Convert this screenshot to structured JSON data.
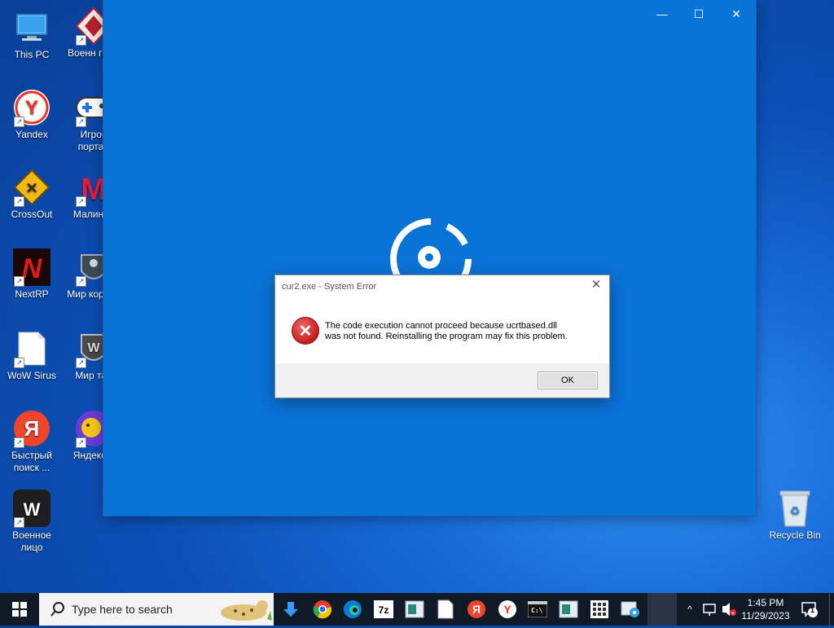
{
  "desktop": {
    "icons_col1": [
      {
        "name": "this-pc",
        "label": "This PC"
      },
      {
        "name": "yandex",
        "label": "Yandex"
      },
      {
        "name": "crossout",
        "label": "CrossOut"
      },
      {
        "name": "nextrp",
        "label": "NextRP"
      },
      {
        "name": "wow-sirus",
        "label": "WoW Sirus"
      },
      {
        "name": "bystry-poisk",
        "label": "Быстрый поиск ..."
      },
      {
        "name": "voennoe-litso",
        "label": "Военное лицо"
      }
    ],
    "icons_col2": [
      {
        "name": "voenny-grom",
        "label": "Военн гром"
      },
      {
        "name": "igrovoy-portal",
        "label": "Игров портал"
      },
      {
        "name": "malinovka",
        "label": "Малинов"
      },
      {
        "name": "mir-korabley",
        "label": "Мир корабл"
      },
      {
        "name": "mir-tankov",
        "label": "Мир тан"
      },
      {
        "name": "yandex-igry",
        "label": "Яндекс и"
      }
    ],
    "recycle_bin": "Recycle Bin"
  },
  "app_window": {
    "minimize": "—",
    "maximize": "☐",
    "close": "✕"
  },
  "dialog": {
    "title": "cur2.exe - System Error",
    "close": "✕",
    "message_line1": "The code execution cannot proceed because ucrtbased.dll",
    "message_line2": "was not found. Reinstalling the program may fix this problem.",
    "ok_label": "OK"
  },
  "taskbar": {
    "search_placeholder": "Type here to search",
    "clock_time": "1:45 PM",
    "clock_date": "11/29/2023",
    "notification_count": "1"
  }
}
